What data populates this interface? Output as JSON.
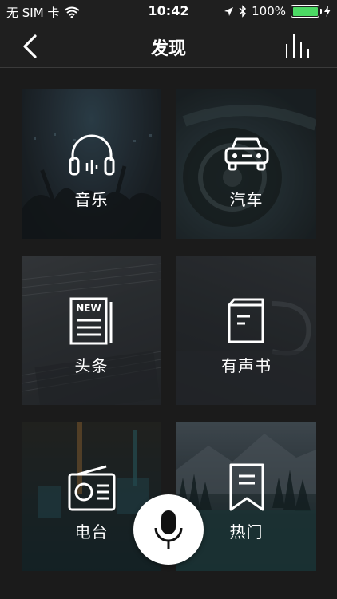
{
  "status_bar": {
    "carrier": "无 SIM 卡",
    "time": "10:42",
    "battery_percent": "100%",
    "battery_level": 1.0,
    "battery_color": "#4cd964"
  },
  "nav": {
    "title": "发现",
    "back_icon": "chevron-left-icon",
    "right_icon": "equalizer-icon"
  },
  "categories": [
    {
      "label": "音乐",
      "icon": "headphones-icon"
    },
    {
      "label": "汽车",
      "icon": "car-icon"
    },
    {
      "label": "头条",
      "icon": "newspaper-icon",
      "icon_text": "NEW"
    },
    {
      "label": "有声书",
      "icon": "book-icon"
    },
    {
      "label": "电台",
      "icon": "radio-icon"
    },
    {
      "label": "热门",
      "icon": "bookmark-icon"
    }
  ],
  "mic": {
    "icon": "microphone-icon",
    "background": "#ffffff"
  }
}
